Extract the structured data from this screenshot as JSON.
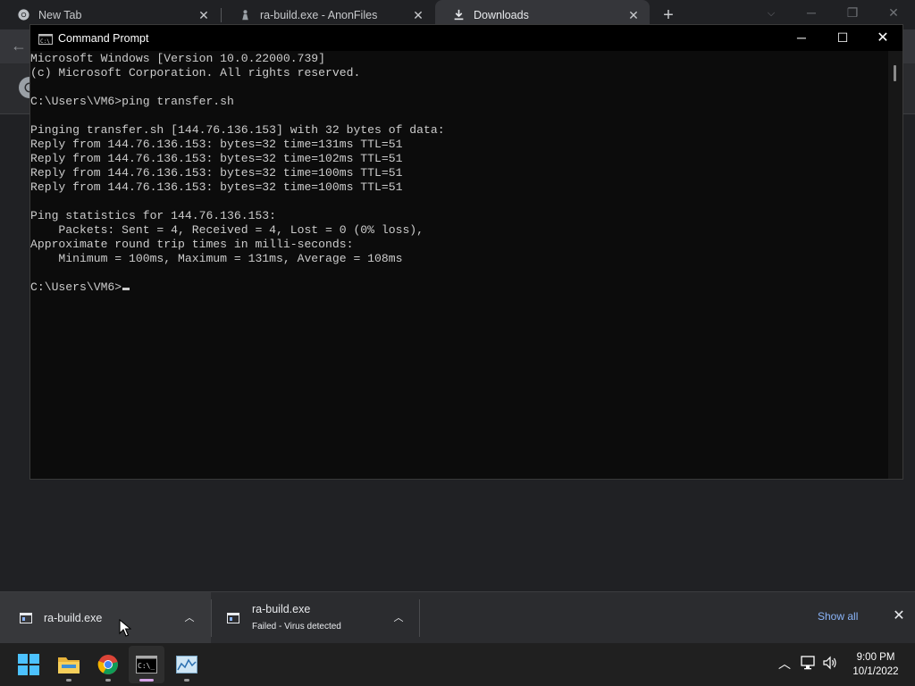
{
  "browser": {
    "tabs": [
      {
        "label": "New Tab",
        "icon": "chrome-icon"
      },
      {
        "label": "ra-build.exe - AnonFiles",
        "icon": "anonfiles-icon"
      },
      {
        "label": "Downloads",
        "icon": "download-icon"
      }
    ]
  },
  "cmd": {
    "title": "Command Prompt",
    "lines": [
      "Microsoft Windows [Version 10.0.22000.739]",
      "(c) Microsoft Corporation. All rights reserved.",
      "",
      "C:\\Users\\VM6>ping transfer.sh",
      "",
      "Pinging transfer.sh [144.76.136.153] with 32 bytes of data:",
      "Reply from 144.76.136.153: bytes=32 time=131ms TTL=51",
      "Reply from 144.76.136.153: bytes=32 time=102ms TTL=51",
      "Reply from 144.76.136.153: bytes=32 time=100ms TTL=51",
      "Reply from 144.76.136.153: bytes=32 time=100ms TTL=51",
      "",
      "Ping statistics for 144.76.136.153:",
      "    Packets: Sent = 4, Received = 4, Lost = 0 (0% loss),",
      "Approximate round trip times in milli-seconds:",
      "    Minimum = 100ms, Maximum = 131ms, Average = 108ms",
      ""
    ],
    "prompt": "C:\\Users\\VM6>"
  },
  "downloads": {
    "items": [
      {
        "name": "ra-build.exe",
        "status": ""
      },
      {
        "name": "ra-build.exe",
        "status": "Failed - Virus detected"
      }
    ],
    "show_all": "Show all"
  },
  "taskbar": {
    "apps": [
      "start-button",
      "file-explorer",
      "chrome",
      "command-prompt",
      "resource-monitor"
    ],
    "time": "9:00 PM",
    "date": "10/1/2022"
  },
  "colors": {
    "accent_link": "#8ab4f8",
    "terminal_text": "#cccccc",
    "terminal_bg": "#0c0c0c"
  }
}
